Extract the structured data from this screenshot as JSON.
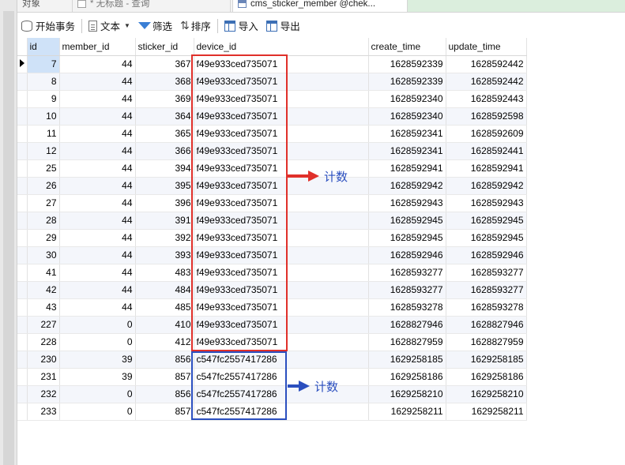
{
  "tabs": [
    {
      "label": "对象"
    },
    {
      "label": "* 无标题 - 查询"
    },
    {
      "label": "cms_sticker_member @chek..."
    },
    {
      "label": ""
    }
  ],
  "toolbar": {
    "begin_transaction": "开始事务",
    "text": "文本",
    "filter": "筛选",
    "sort": "排序",
    "import": "导入",
    "export": "导出"
  },
  "table": {
    "columns": [
      "id",
      "member_id",
      "sticker_id",
      "device_id",
      "create_time",
      "update_time"
    ],
    "rows": [
      [
        "7",
        "44",
        "367",
        "f49e933ced735071",
        "1628592339",
        "1628592442"
      ],
      [
        "8",
        "44",
        "368",
        "f49e933ced735071",
        "1628592339",
        "1628592442"
      ],
      [
        "9",
        "44",
        "369",
        "f49e933ced735071",
        "1628592340",
        "1628592443"
      ],
      [
        "10",
        "44",
        "364",
        "f49e933ced735071",
        "1628592340",
        "1628592598"
      ],
      [
        "11",
        "44",
        "365",
        "f49e933ced735071",
        "1628592341",
        "1628592609"
      ],
      [
        "12",
        "44",
        "366",
        "f49e933ced735071",
        "1628592341",
        "1628592441"
      ],
      [
        "25",
        "44",
        "394",
        "f49e933ced735071",
        "1628592941",
        "1628592941"
      ],
      [
        "26",
        "44",
        "395",
        "f49e933ced735071",
        "1628592942",
        "1628592942"
      ],
      [
        "27",
        "44",
        "396",
        "f49e933ced735071",
        "1628592943",
        "1628592943"
      ],
      [
        "28",
        "44",
        "391",
        "f49e933ced735071",
        "1628592945",
        "1628592945"
      ],
      [
        "29",
        "44",
        "392",
        "f49e933ced735071",
        "1628592945",
        "1628592945"
      ],
      [
        "30",
        "44",
        "393",
        "f49e933ced735071",
        "1628592946",
        "1628592946"
      ],
      [
        "41",
        "44",
        "483",
        "f49e933ced735071",
        "1628593277",
        "1628593277"
      ],
      [
        "42",
        "44",
        "484",
        "f49e933ced735071",
        "1628593277",
        "1628593277"
      ],
      [
        "43",
        "44",
        "485",
        "f49e933ced735071",
        "1628593278",
        "1628593278"
      ],
      [
        "227",
        "0",
        "410",
        "f49e933ced735071",
        "1628827946",
        "1628827946"
      ],
      [
        "228",
        "0",
        "412",
        "f49e933ced735071",
        "1628827959",
        "1628827959"
      ],
      [
        "230",
        "39",
        "856",
        "c547fc2557417286",
        "1629258185",
        "1629258185"
      ],
      [
        "231",
        "39",
        "857",
        "c547fc2557417286",
        "1629258186",
        "1629258186"
      ],
      [
        "232",
        "0",
        "856",
        "c547fc2557417286",
        "1629258210",
        "1629258210"
      ],
      [
        "233",
        "0",
        "857",
        "c547fc2557417286",
        "1629258211",
        "1629258211"
      ]
    ]
  },
  "annotations": {
    "red_label": "计数",
    "blue_label": "计数",
    "red_color": "#e0302a",
    "blue_color": "#2b4fbf"
  }
}
